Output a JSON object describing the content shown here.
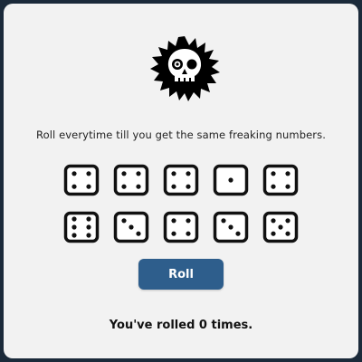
{
  "logo": {
    "icon": "spiky-skull-icon"
  },
  "instruction": "Roll everytime till you get the same freaking numbers.",
  "dice": {
    "rows": [
      [
        4,
        4,
        4,
        1,
        4
      ],
      [
        6,
        3,
        4,
        3,
        5
      ]
    ]
  },
  "roll_button": {
    "label": "Roll",
    "color": "#2e5e8c"
  },
  "status": {
    "counter_text": "You've rolled 0 times."
  },
  "colors": {
    "background": "#1b2a3a",
    "card": "#f2f2f2",
    "ink": "#111111"
  }
}
